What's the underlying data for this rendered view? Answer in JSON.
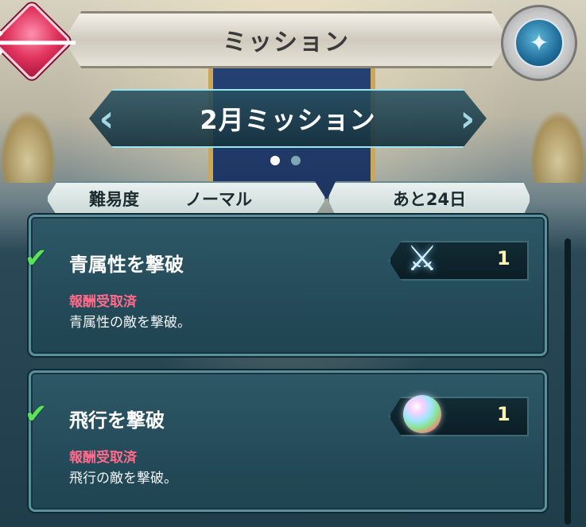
{
  "header": {
    "title": "ミッション",
    "back_icon": "back-arrow-icon",
    "emblem_icon": "my-nintendo-emblem-icon",
    "back_glyph": "🡐"
  },
  "month": {
    "label": "2月ミッション",
    "page_count": 2,
    "active_page": 1
  },
  "info": {
    "difficulty_label": "難易度",
    "difficulty_value": "ノーマル",
    "remaining": "あと24日"
  },
  "missions": [
    {
      "title": "青属性を撃破",
      "status": "報酬受取済",
      "description": "青属性の敵を撃破。",
      "completed": true,
      "reward_icon": "sword-icon",
      "reward_count": "1"
    },
    {
      "title": "飛行を撃破",
      "status": "報酬受取済",
      "description": "飛行の敵を撃破。",
      "completed": true,
      "reward_icon": "orb-icon",
      "reward_count": "1"
    }
  ],
  "colors": {
    "status_text": "#ff6b8a",
    "check": "#5be35a",
    "panel": "#244b59"
  }
}
